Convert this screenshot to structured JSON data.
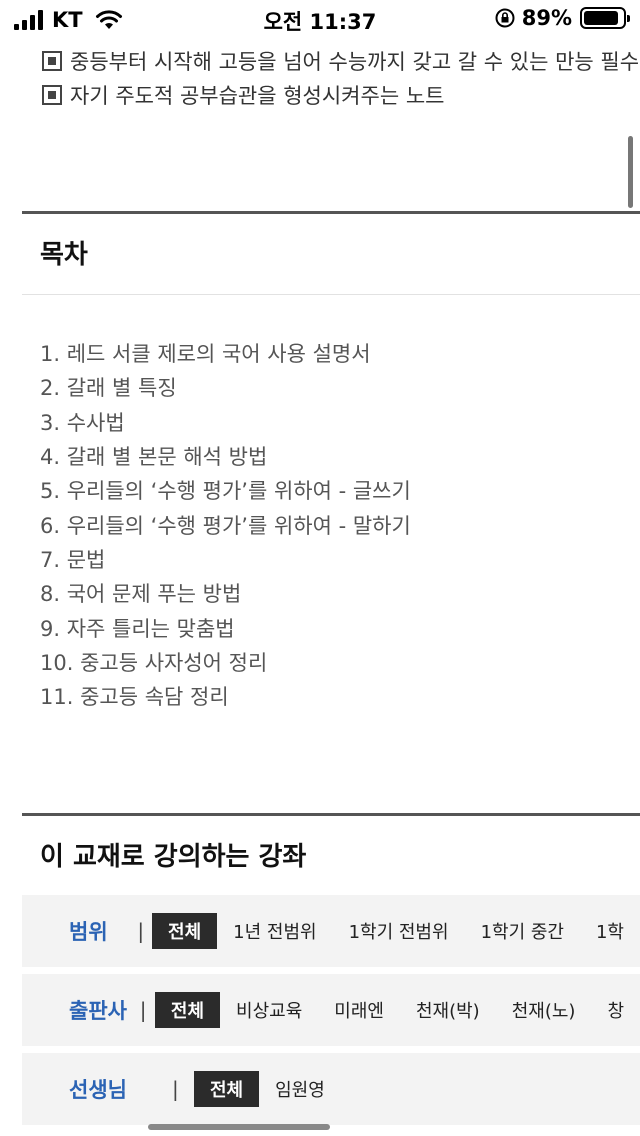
{
  "status_bar": {
    "carrier": "KT",
    "time": "오전 11:37",
    "battery": "89%",
    "battery_level": 0.89
  },
  "features": [
    "중등부터 시작해 고등을 넘어 수능까지 갖고 갈 수 있는 만능 필수 노",
    "자기 주도적 공부습관을 형성시켜주는 노트"
  ],
  "toc": {
    "title": "목차",
    "items": [
      "1. 레드 서클 제로의 국어 사용 설명서",
      "2. 갈래 별 특징",
      "3. 수사법",
      "4. 갈래 별 본문 해석 방법",
      "5. 우리들의 ‘수행 평가’를 위하여 - 글쓰기",
      "6. 우리들의 ‘수행 평가’를 위하여 - 말하기",
      "7. 문법",
      "8. 국어 문제 푸는 방법",
      "9. 자주 틀리는 맞춤법",
      "10. 중고등 사자성어 정리",
      "11. 중고등 속담 정리"
    ]
  },
  "lectures": {
    "title": "이 교재로 강의하는 강좌",
    "separator": "|",
    "filters": [
      {
        "label": "범위",
        "options": [
          "전체",
          "1년 전범위",
          "1학기 전범위",
          "1학기 중간",
          "1학"
        ],
        "selected": "전체"
      },
      {
        "label": "출판사",
        "options": [
          "전체",
          "비상교육",
          "미래엔",
          "천재(박)",
          "천재(노)",
          "창"
        ],
        "selected": "전체"
      },
      {
        "label": "선생님",
        "options": [
          "전체",
          "임원영"
        ],
        "selected": "전체"
      }
    ]
  },
  "colors": {
    "accent": "#2b63b4",
    "chip_active_bg": "#2b2b2b",
    "filter_bg": "#f3f3f3"
  }
}
